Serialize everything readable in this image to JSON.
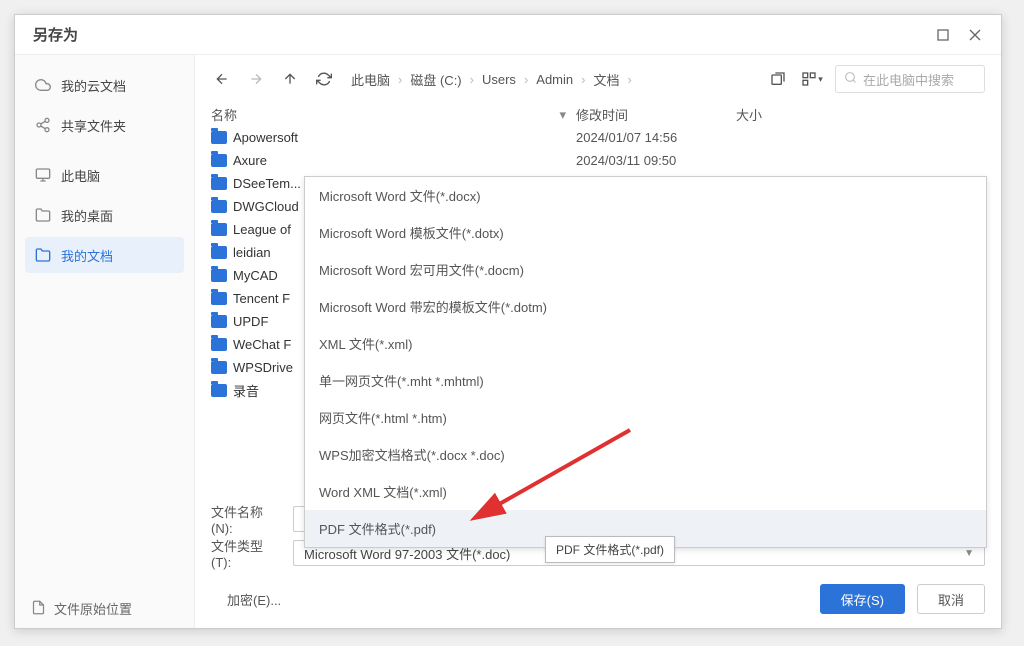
{
  "title": "另存为",
  "sidebar": {
    "items": [
      {
        "label": "我的云文档",
        "icon": "cloud-icon"
      },
      {
        "label": "共享文件夹",
        "icon": "share-icon"
      },
      {
        "label": "此电脑",
        "icon": "monitor-icon"
      },
      {
        "label": "我的桌面",
        "icon": "folder-icon"
      },
      {
        "label": "我的文档",
        "icon": "folder-icon",
        "active": true
      }
    ]
  },
  "breadcrumb": [
    "此电脑",
    "磁盘 (C:)",
    "Users",
    "Admin",
    "文档"
  ],
  "search": {
    "placeholder": "在此电脑中搜索"
  },
  "cols": {
    "name": "名称",
    "date": "修改时间",
    "size": "大小"
  },
  "files": [
    {
      "name": "Apowersoft",
      "date": "2024/01/07 14:56"
    },
    {
      "name": "Axure",
      "date": "2024/03/11 09:50"
    },
    {
      "name": "DSeeTem...",
      "date": ""
    },
    {
      "name": "DWGCloud",
      "date": ""
    },
    {
      "name": "League of",
      "date": ""
    },
    {
      "name": "leidian",
      "date": ""
    },
    {
      "name": "MyCAD",
      "date": ""
    },
    {
      "name": "Tencent F",
      "date": ""
    },
    {
      "name": "UPDF",
      "date": ""
    },
    {
      "name": "WeChat F",
      "date": ""
    },
    {
      "name": "WPSDrive",
      "date": ""
    },
    {
      "name": "录音",
      "date": ""
    }
  ],
  "dropdown": [
    "Microsoft Word 文件(*.docx)",
    "Microsoft Word 模板文件(*.dotx)",
    "Microsoft Word 宏可用文件(*.docm)",
    "Microsoft Word 带宏的模板文件(*.dotm)",
    "XML 文件(*.xml)",
    "单一网页文件(*.mht *.mhtml)",
    "网页文件(*.html *.htm)",
    "WPS加密文档格式(*.docx *.doc)",
    "Word XML 文档(*.xml)",
    "PDF 文件格式(*.pdf)"
  ],
  "tooltip": "PDF 文件格式(*.pdf)",
  "fields": {
    "name_label": "文件名称(N):",
    "type_label": "文件类型(T):",
    "type_value": "Microsoft Word 97-2003 文件(*.doc)"
  },
  "encrypt_label": "加密(E)...",
  "footer": {
    "origin": "文件原始位置",
    "save": "保存(S)",
    "cancel": "取消"
  }
}
